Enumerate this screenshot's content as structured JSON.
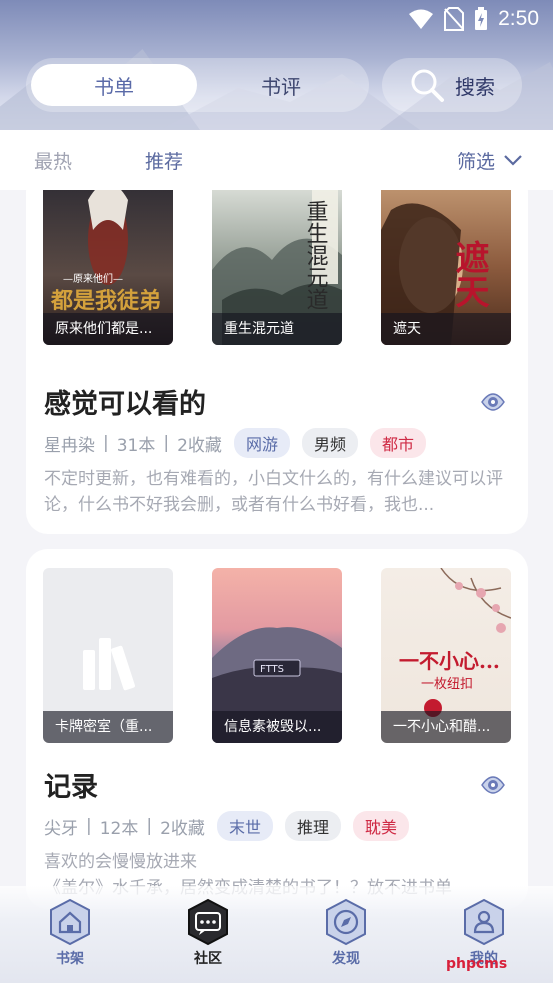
{
  "status": {
    "time": "2:50"
  },
  "header": {
    "tabs": [
      {
        "label": "书单"
      },
      {
        "label": "书评"
      }
    ],
    "search_label": "搜索"
  },
  "filters": {
    "hot": "最热",
    "recommend": "推荐",
    "filter": "筛选"
  },
  "lists": [
    {
      "title": "感觉可以看的",
      "author": "星冉染",
      "count": "31本",
      "favorites": "2收藏",
      "tags": [
        "网游",
        "男频",
        "都市"
      ],
      "description": "不定时更新，也有难看的，小白文什么的，有什么建议可以评论，什么书不好我会删，或者有什么书好看，我也...",
      "books": [
        {
          "caption": "原来他们都是...",
          "cover_text": "都是我徒弟",
          "cover_sub": "—原来他们—"
        },
        {
          "caption": "重生混元道",
          "cover_text": "重生混元道"
        },
        {
          "caption": "遮天",
          "cover_text": "遮天"
        }
      ]
    },
    {
      "title": "记录",
      "author": "尖牙",
      "count": "12本",
      "favorites": "2收藏",
      "tags": [
        "末世",
        "推理",
        "耽美"
      ],
      "description": "喜欢的会慢慢放进来",
      "description2": "《盖尔》水千承，居然变成清楚的书了！？放不进书单",
      "books": [
        {
          "caption": "卡牌密室（重..."
        },
        {
          "caption": "信息素被毁以...",
          "cover_text": "FTTS"
        },
        {
          "caption": "一不小心和醋...",
          "cover_text": "一不小心...",
          "cover_sub": "一枚纽扣"
        }
      ]
    }
  ],
  "nav": [
    {
      "label": "书架",
      "icon": "house-icon"
    },
    {
      "label": "社区",
      "icon": "chat-icon"
    },
    {
      "label": "发现",
      "icon": "compass-icon"
    },
    {
      "label": "我的",
      "icon": "person-icon"
    }
  ],
  "watermark": "phpcms"
}
